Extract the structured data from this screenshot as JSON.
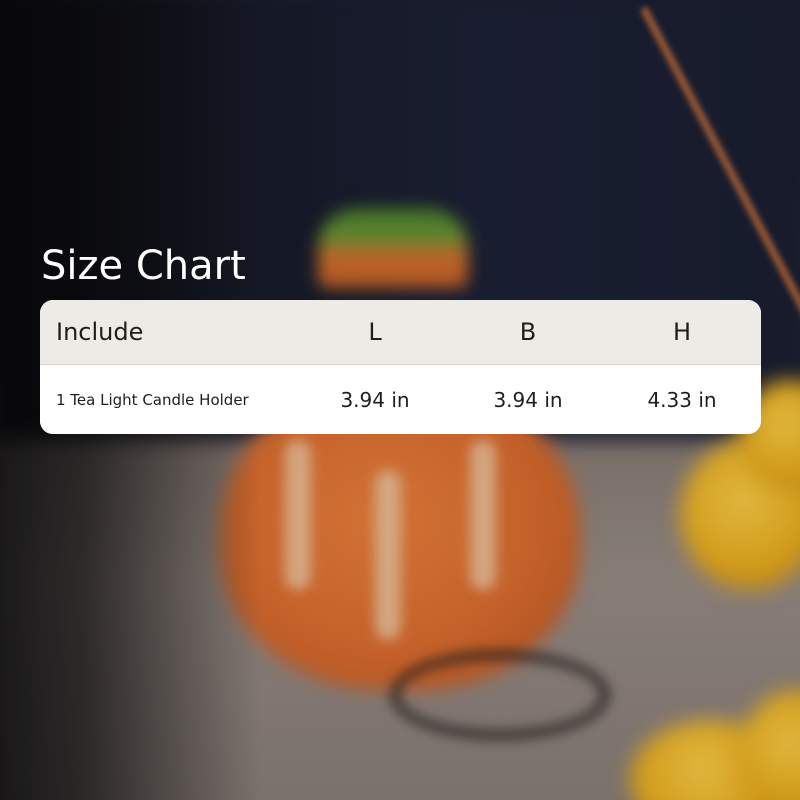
{
  "title": "Size Chart",
  "table": {
    "headers": [
      "Include",
      "L",
      "B",
      "H"
    ],
    "rows": [
      [
        "1 Tea Light Candle Holder",
        "3.94 in",
        "3.94 in",
        "4.33 in"
      ]
    ]
  },
  "colors": {
    "header_bg": "#ecebe5",
    "body_bg": "#ffffff",
    "title_text": "#ffffff",
    "table_text": "#1e1e1e"
  }
}
